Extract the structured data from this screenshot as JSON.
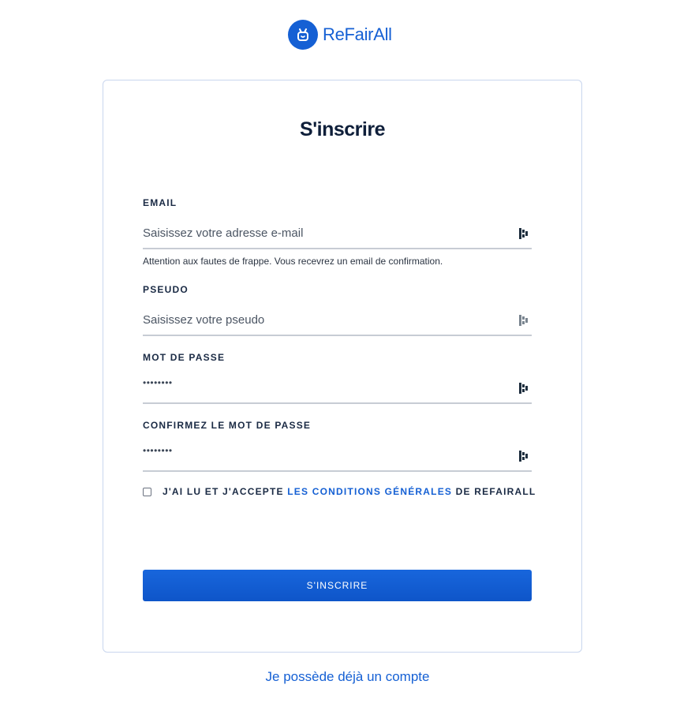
{
  "brand": {
    "name": "ReFairAll",
    "color": "#1560d4",
    "logo_icon": "refairall-logo-icon"
  },
  "form": {
    "title": "S'inscrire",
    "email": {
      "label": "EMAIL",
      "placeholder": "Saisissez votre adresse e-mail",
      "value": "",
      "hint": "Attention aux fautes de frappe. Vous recevrez un email de confirmation."
    },
    "pseudo": {
      "label": "PSEUDO",
      "placeholder": "Saisissez votre pseudo",
      "value": ""
    },
    "password": {
      "label": "MOT DE PASSE",
      "masked_value": "••••••••"
    },
    "confirm_password": {
      "label": "CONFIRMEZ LE MOT DE PASSE",
      "masked_value": "••••••••"
    },
    "terms": {
      "prefix": "J'AI LU ET J'ACCEPTE",
      "link": "LES CONDITIONS GÉNÉRALES",
      "suffix": "DE REFAIRALL",
      "checked": false
    },
    "submit_label": "S'INSCRIRE"
  },
  "login_link": "Je possède déjà un compte",
  "colors": {
    "accent": "#1560d4",
    "field_border": "#c7ccd4",
    "card_border": "#c9d6ee"
  },
  "icons": {
    "field_icon": "password-manager-icon"
  }
}
